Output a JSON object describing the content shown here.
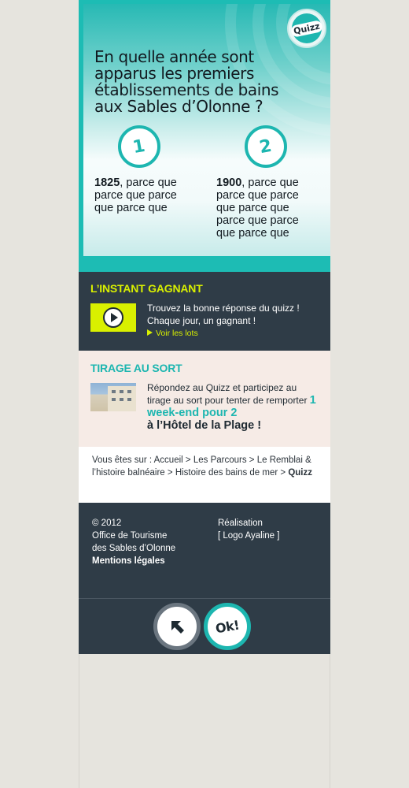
{
  "hero": {
    "badge_label": "Quizz",
    "question": "En quelle année sont apparus les premiers établissements de bains aux Sables d’Olonne ?",
    "answers": [
      {
        "number": "1",
        "year": "1825",
        "text": ", parce que parce que parce que parce que"
      },
      {
        "number": "2",
        "year": "1900",
        "text": ", parce que parce que parce que parce que parce que parce que parce que"
      }
    ]
  },
  "instant": {
    "title": "L’INSTANT GAGNANT",
    "text": "Trouvez la bonne réponse du quizz ! Chaque jour, un gagnant !",
    "link": "Voir les lots"
  },
  "tirage": {
    "title": "TIRAGE AU SORT",
    "text": "Répondez au Quizz et participez au tirage au sort pour tenter de remporter",
    "highlight": "1 week-end pour 2",
    "hotel": "à l’Hôtel de la Plage !"
  },
  "breadcrumb": {
    "prefix": "Vous êtes sur : ",
    "items": [
      "Accueil",
      "Les Parcours",
      "Le Remblai & l’histoire balnéaire",
      "Histoire des bains de mer"
    ],
    "separator": " > ",
    "current": "Quizz"
  },
  "footer": {
    "copyright": "© 2012",
    "org_line1": "Office de Tourisme",
    "org_line2": "des Sables d’Olonne",
    "legal": "Mentions légales",
    "realisation": "Réalisation",
    "logo": "[ Logo Ayaline ]",
    "ok_label": "Ok!"
  },
  "colors": {
    "teal": "#1db6b0",
    "dark": "#2f3c47",
    "lime": "#d9f000",
    "cream": "#f6ebe6"
  }
}
